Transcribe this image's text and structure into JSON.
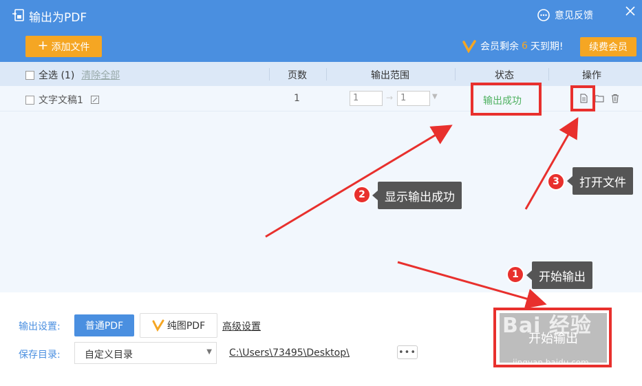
{
  "header": {
    "title": "输出为PDF",
    "feedback_label": "意见反馈",
    "add_file_label": "添加文件",
    "vip_prefix": "会员剩余",
    "vip_days": "6",
    "vip_suffix": "天到期!",
    "renew_label": "续费会员"
  },
  "table": {
    "select_all_label": "全选 (1)",
    "clear_all_label": "清除全部",
    "columns": {
      "pages": "页数",
      "range": "输出范围",
      "status": "状态",
      "actions": "操作"
    },
    "rows": [
      {
        "name": "文字文稿1",
        "pages": "1",
        "range_from": "1",
        "range_to": "1",
        "status": "输出成功"
      }
    ]
  },
  "settings": {
    "output_label": "输出设置:",
    "normal_pdf_label": "普通PDF",
    "image_pdf_label": "纯图PDF",
    "advanced_label": "高级设置",
    "save_dir_label": "保存目录:",
    "save_dir_value": "自定义目录",
    "save_path": "C:\\Users\\73495\\Desktop\\",
    "more_label": "•••",
    "start_label": "开始输出"
  },
  "annotations": {
    "steps": [
      {
        "num": "1",
        "text": "开始输出"
      },
      {
        "num": "2",
        "text": "显示输出成功"
      },
      {
        "num": "3",
        "text": "打开文件"
      }
    ],
    "watermark": "Bai 经验",
    "watermark_sub": "jingyan.baidu.com"
  },
  "colors": {
    "header_blue": "#4a8fe0",
    "orange": "#f5a623",
    "success_green": "#4cb05e",
    "annotation_red": "#e8302d"
  }
}
